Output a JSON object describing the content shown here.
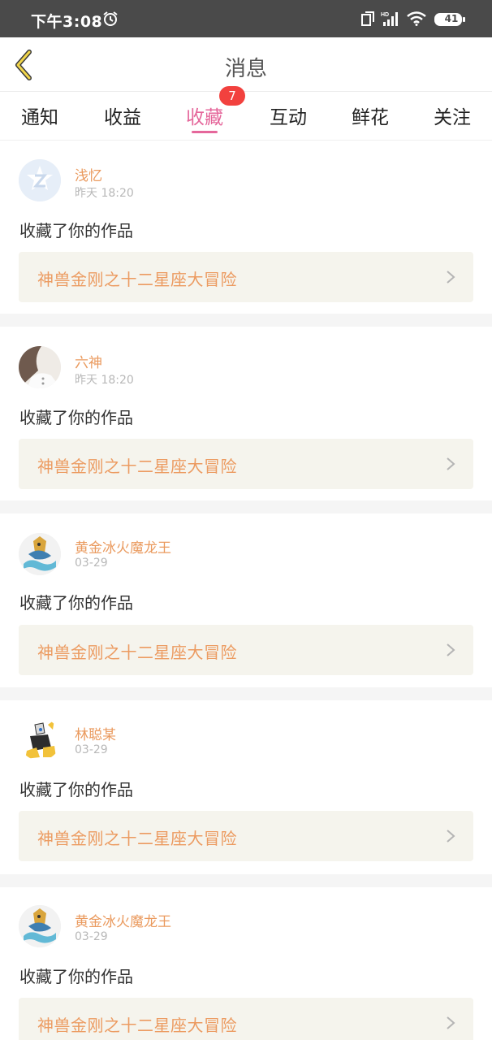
{
  "status_bar": {
    "time": "下午3:08",
    "battery": "41"
  },
  "header": {
    "title": "消息"
  },
  "tabs": [
    {
      "label": "通知"
    },
    {
      "label": "收益"
    },
    {
      "label": "收藏",
      "active": true,
      "badge": "7"
    },
    {
      "label": "互动"
    },
    {
      "label": "鲜花"
    },
    {
      "label": "关注"
    }
  ],
  "messages": [
    {
      "user": "浅忆",
      "time": "昨天 18:20",
      "action": "收藏了你的作品",
      "work": "神兽金刚之十二星座大冒险",
      "avatar": "qq-default-avatar"
    },
    {
      "user": "六神",
      "time": "昨天 18:20",
      "action": "收藏了你的作品",
      "work": "神兽金刚之十二星座大冒险",
      "avatar": "photo-avatar"
    },
    {
      "user": "黄金冰火魔龙王",
      "time": "03-29",
      "action": "收藏了你的作品",
      "work": "神兽金刚之十二星座大冒险",
      "avatar": "dragon-avatar"
    },
    {
      "user": "林聪某",
      "time": "03-29",
      "action": "收藏了你的作品",
      "work": "神兽金刚之十二星座大冒险",
      "avatar": "robot-avatar"
    },
    {
      "user": "黄金冰火魔龙王",
      "time": "03-29",
      "action": "收藏了你的作品",
      "work": "神兽金刚之十二星座大冒险",
      "avatar": "dragon-avatar"
    }
  ],
  "colors": {
    "accent": "#e5679b",
    "username": "#ea9a5e",
    "work_title": "#ec9b61",
    "badge": "#f2413e"
  }
}
